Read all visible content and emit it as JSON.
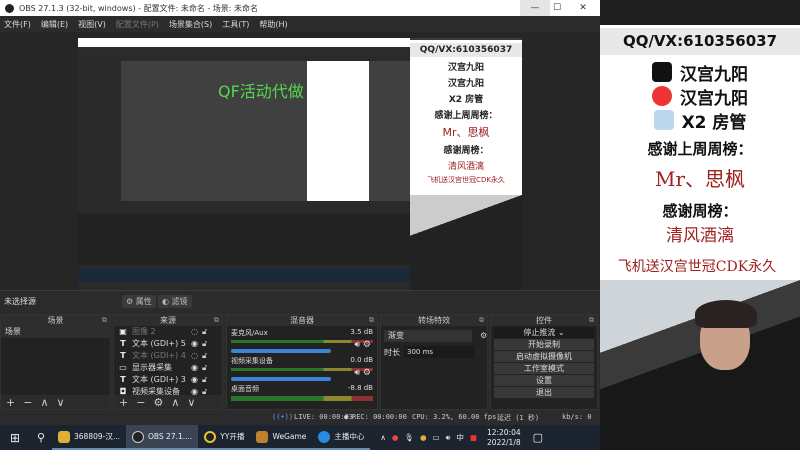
{
  "window": {
    "title": "OBS 27.1.3 (32-bit, windows) - 配置文件: 未命名 - 场景: 未命名",
    "minimize": "—",
    "maximize": "☐",
    "close": "✕"
  },
  "menu": [
    "文件(F)",
    "编辑(E)",
    "视图(V)",
    "配置文件(P)",
    "场景集合(S)",
    "工具(T)",
    "帮助(H)"
  ],
  "preview": {
    "overlay_text": "QF活动代做"
  },
  "source_bar": {
    "label": "未选择源",
    "properties": "属性",
    "filters": "滤镜"
  },
  "scenes": {
    "title": "场景",
    "items": [
      "场景"
    ]
  },
  "sources": {
    "title": "来源",
    "items": [
      {
        "icon": "image",
        "name": "图像 2",
        "visible": false
      },
      {
        "icon": "text",
        "name": "文本 (GDI+) 5",
        "visible": true
      },
      {
        "icon": "text",
        "name": "文本 (GDI+) 4",
        "visible": false
      },
      {
        "icon": "monitor",
        "name": "显示器采集",
        "visible": true
      },
      {
        "icon": "text",
        "name": "文本 (GDI+) 3",
        "visible": true
      },
      {
        "icon": "camera",
        "name": "视频采集设备",
        "visible": true
      }
    ]
  },
  "mixer": {
    "title": "混音器",
    "channels": [
      {
        "name": "麦克风/Aux",
        "db": "3.5 dB"
      },
      {
        "name": "视频采集设备",
        "db": "0.0 dB"
      },
      {
        "name": "桌面音频",
        "db": "-8.8 dB"
      }
    ]
  },
  "transitions": {
    "title": "转场特效",
    "type": "渐变",
    "duration_label": "时长",
    "duration": "300 ms"
  },
  "controls": {
    "title": "控件",
    "buttons": [
      "停止推流",
      "开始录制",
      "启动虚拟摄像机",
      "工作室模式",
      "设置",
      "退出"
    ]
  },
  "status": {
    "live": "LIVE: 00:00:03",
    "rec": "REC: 00:00:00",
    "cpu": "CPU: 3.2%, 60.00 fps",
    "delay": "延迟 (1 秒)",
    "kbps": "kb/s: 0"
  },
  "taskbar": {
    "apps": [
      "368809-汉...",
      "OBS 27.1....",
      "YY开播",
      "WeGame",
      "主播中心"
    ],
    "time": "12:20:04",
    "date": "2022/1/8",
    "ime": "中"
  },
  "stream_overlay": {
    "qq": "QQ/VX:610356037",
    "douyin": "汉宫九阳",
    "weibo": "汉宫九阳",
    "x2": "X2 房管",
    "last_week_title": "感谢上周周榜：",
    "last_week_name": "Mr、思枫",
    "week_title": "感谢周榜：",
    "week_name": "清风酒漓",
    "promo": "飞机送汉宫世冠CDK永久"
  },
  "colors": {
    "accent": "#3a84d6",
    "red_text": "#a02020"
  }
}
